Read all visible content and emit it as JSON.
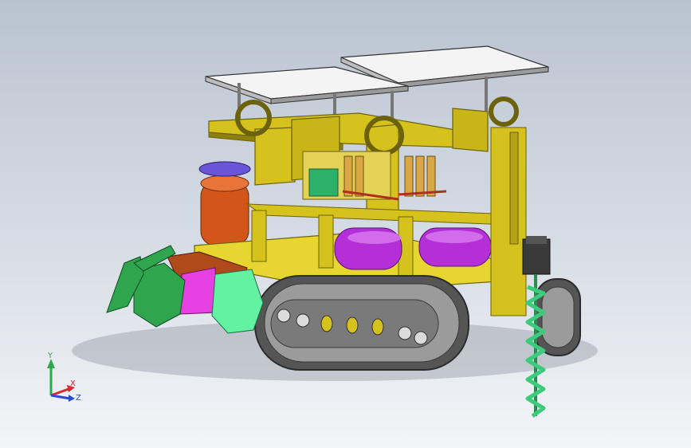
{
  "viewport": {
    "scene": "cad-model-tracked-vehicle",
    "colors": {
      "frame": "#d6c21c",
      "frame_dark": "#8d7f10",
      "frame_light": "#efe26a",
      "panel": "#f2f2f2",
      "tank": "#b52fd8",
      "tank_light": "#d97cf0",
      "orange": "#d2561a",
      "violet": "#6a55d8",
      "magenta": "#e640e2",
      "green": "#2fa64e",
      "mint": "#63f2a2",
      "track": "#9b9b9b",
      "track_dark": "#555555",
      "drill": "#3ccb7a",
      "motor": "#3a3a3a",
      "brown": "#b04a1a"
    }
  },
  "triad": {
    "y_label": "Y",
    "x_label": "X",
    "z_label": "Z",
    "colors": {
      "y": "#2ea84b",
      "x": "#d52b2b",
      "z": "#2b4bd5"
    }
  }
}
